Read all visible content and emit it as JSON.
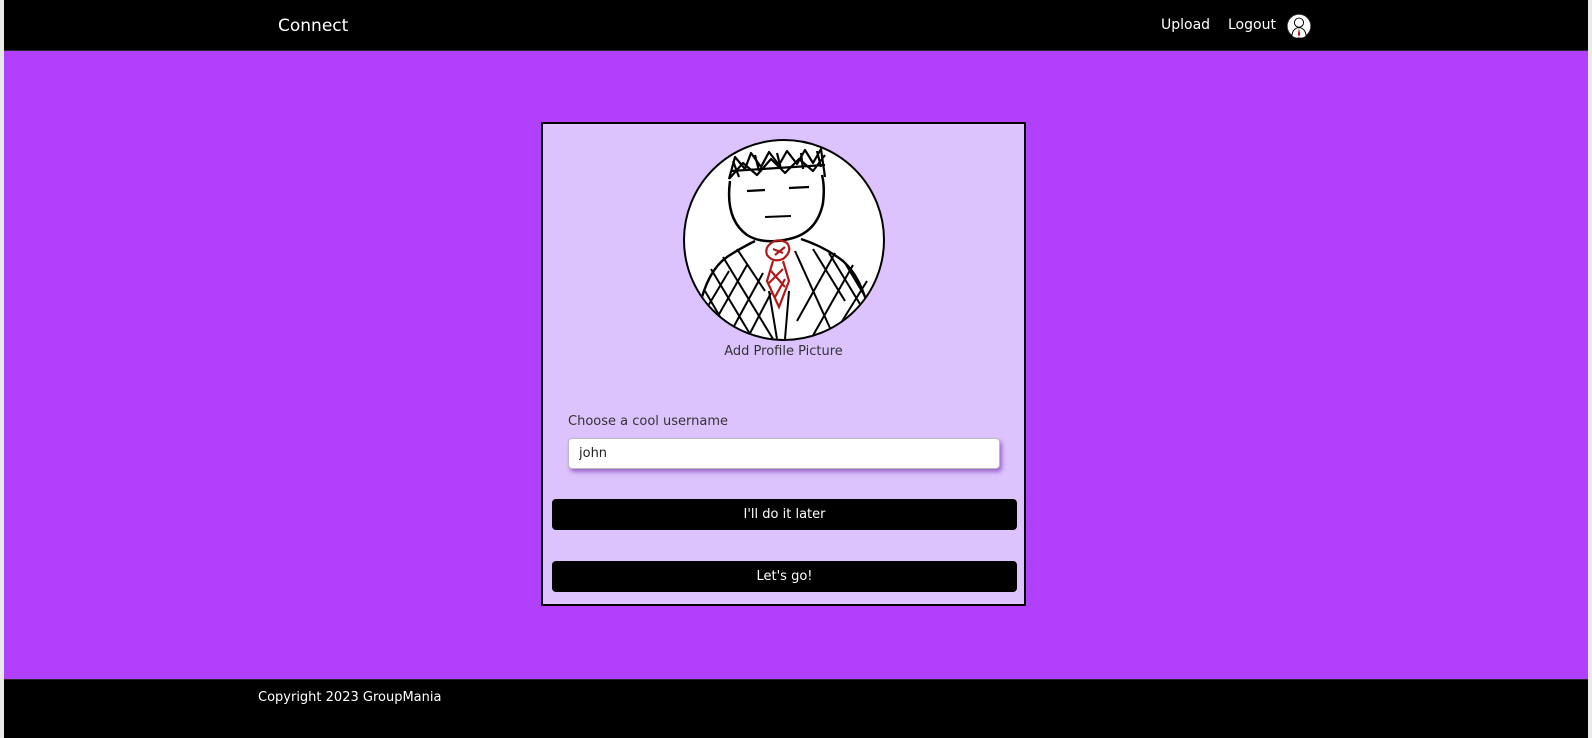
{
  "navbar": {
    "brand": "Connect",
    "links": {
      "upload": "Upload",
      "logout": "Logout"
    },
    "avatar_icon": "user-avatar-icon"
  },
  "card": {
    "profile_picture_icon": "sketch-avatar-icon",
    "add_picture_label": "Add Profile Picture",
    "username_label": "Choose a cool username",
    "username_value": "john",
    "later_button": "I'll do it later",
    "go_button": "Let's go!"
  },
  "footer": {
    "copyright": "Copyright 2023 GroupMania"
  },
  "colors": {
    "page_background": "#b23ffb",
    "card_background": "#ddc3fd",
    "bar_background": "#000000",
    "tie": "#b01a1a"
  }
}
